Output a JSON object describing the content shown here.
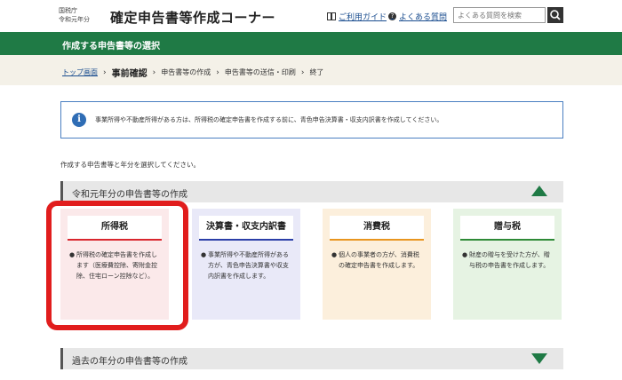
{
  "header": {
    "agency_line1": "国税庁",
    "agency_line2": "令和元年分",
    "site_title": "確定申告書等作成コーナー",
    "guide_icon": "book-icon",
    "guide_label": "ご利用ガイド",
    "faq_icon": "question-icon",
    "faq_label": "よくある質問",
    "search_placeholder": "よくある質問を検索",
    "search_icon": "search-icon"
  },
  "page": {
    "heading": "作成する申告書等の選択"
  },
  "breadcrumb": {
    "items": [
      "トップ画面",
      "事前確認",
      "申告書等の作成",
      "申告書等の送信・印刷",
      "終了"
    ],
    "separator": "›"
  },
  "notice": {
    "icon": "info-icon",
    "icon_glyph": "i",
    "text": "事業所得や不動産所得がある方は、所得税の確定申告書を作成する前に、青色申告決算書・収支内訳書を作成してください。"
  },
  "instruction": "作成する申告書等と年分を選択してください。",
  "sections": {
    "current": {
      "title": "令和元年分の申告書等の作成",
      "toggle_icon": "triangle-up-icon"
    },
    "past": {
      "title": "過去の年分の申告書等の作成",
      "toggle_icon": "triangle-down-icon"
    }
  },
  "cards": [
    {
      "title": "所得税",
      "bullet": "●",
      "description": "所得税の確定申告書を作成します（医療費控除、寄附金控除、住宅ローン控除など）。"
    },
    {
      "title": "決算書・収支内訳書",
      "bullet": "●",
      "description": "事業所得や不動産所得がある方が、青色申告決算書や収支内訳書を作成します。"
    },
    {
      "title": "消費税",
      "bullet": "●",
      "description": "個人の事業者の方が、消費税の確定申告書を作成します。"
    },
    {
      "title": "贈与税",
      "bullet": "●",
      "description": "財産の贈与を受けた方が、贈与税の申告書を作成します。"
    }
  ],
  "colors": {
    "brand_green": "#1f7a45",
    "highlight_red": "#e11d1d",
    "income_accent": "#d9262e",
    "settlement_accent": "#2b3ea8",
    "consumption_accent": "#e8951f",
    "gift_accent": "#2e8a37"
  }
}
